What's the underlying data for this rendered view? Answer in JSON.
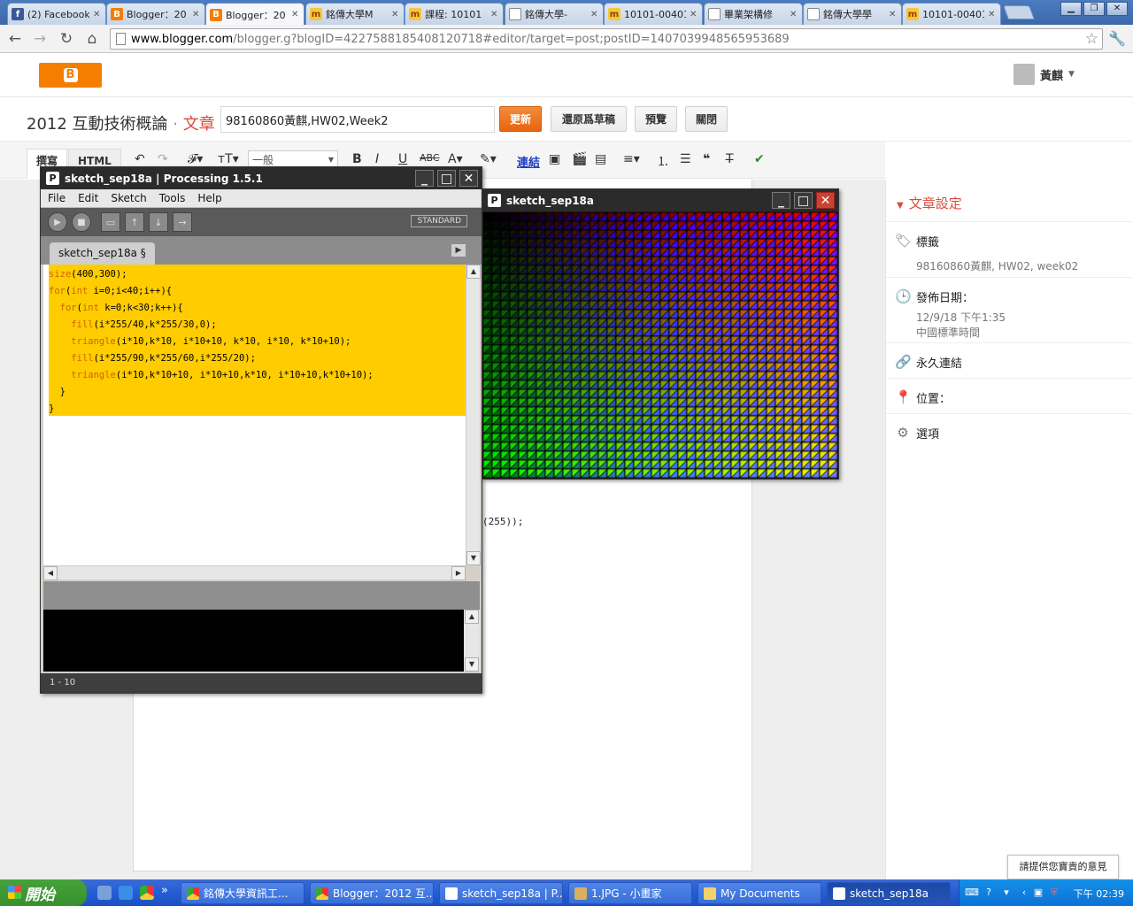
{
  "browser": {
    "tabs": [
      {
        "label": "(2) Facebook",
        "icon": "facebook-icon"
      },
      {
        "label": "Blogger：20",
        "icon": "blogger-icon"
      },
      {
        "label": "Blogger：20",
        "icon": "blogger-icon"
      },
      {
        "label": "銘傳大學M",
        "icon": "moodle-icon"
      },
      {
        "label": "課程: 10101",
        "icon": "moodle-icon"
      },
      {
        "label": "銘傳大學-",
        "icon": "document-icon"
      },
      {
        "label": "10101-00401",
        "icon": "moodle-icon"
      },
      {
        "label": "畢業架構修",
        "icon": "document-icon"
      },
      {
        "label": "銘傳大學學",
        "icon": "document-icon"
      },
      {
        "label": "10101-00401",
        "icon": "moodle-icon"
      }
    ],
    "url_host": "www.blogger.com",
    "url_path": "/blogger.g?blogID=4227588185408120718#editor/target=post;postID=1407039948565953689"
  },
  "blogger": {
    "user_name": "黃麒",
    "blog_title": "2012 互動技術概論",
    "separator": "·",
    "section": "文章",
    "post_title": "98160860黃麒,HW02,Week2",
    "buttons": {
      "update": "更新",
      "revert": "還原爲草稿",
      "preview": "預覽",
      "close": "關閉"
    },
    "editor_tabs": {
      "compose": "撰寫",
      "html": "HTML"
    },
    "font_select": "一般",
    "link_label": "連結",
    "editor_fragment": "(255));"
  },
  "sidebar": {
    "heading": "文章設定",
    "labels_title": "標籤",
    "labels_value": "98160860黃麒, HW02, week02",
    "date_title": "發佈日期：",
    "date_value": "12/9/18 下午1:35",
    "timezone": "中國標準時間",
    "permalink": "永久連結",
    "location": "位置：",
    "options": "選項"
  },
  "processing": {
    "title": "sketch_sep18a | Processing 1.5.1",
    "menu": [
      "File",
      "Edit",
      "Sketch",
      "Tools",
      "Help"
    ],
    "mode": "STANDARD",
    "tab_name": "sketch_sep18a §",
    "code_lines": [
      "size(400,300);",
      "for(int i=0;i<40;i++){",
      "  for(int k=0;k<30;k++){",
      "    fill(i*255/40,k*255/30,0);",
      "    triangle(i*10,k*10, i*10+10, k*10, i*10, k*10+10);",
      "    fill(i*255/90,k*255/60,i*255/20);",
      "    triangle(i*10,k*10+10, i*10+10,k*10, i*10+10,k*10+10);",
      "  }",
      "}"
    ],
    "status": "1 - 10"
  },
  "sketch": {
    "title": "sketch_sep18a",
    "cols": 40,
    "rows": 30
  },
  "feedback": "請提供您寶貴的意見",
  "taskbar": {
    "start": "開始",
    "items": [
      "銘傳大學資訊工...",
      "Blogger：2012 互...",
      "sketch_sep18a | P...",
      "1.JPG - 小畫家",
      "My Documents",
      "sketch_sep18a"
    ],
    "clock": "下午 02:39"
  },
  "colors": {
    "blogger_orange": "#f57d00",
    "accent_red": "#dd4b39",
    "code_highlight": "#ffcc00"
  }
}
